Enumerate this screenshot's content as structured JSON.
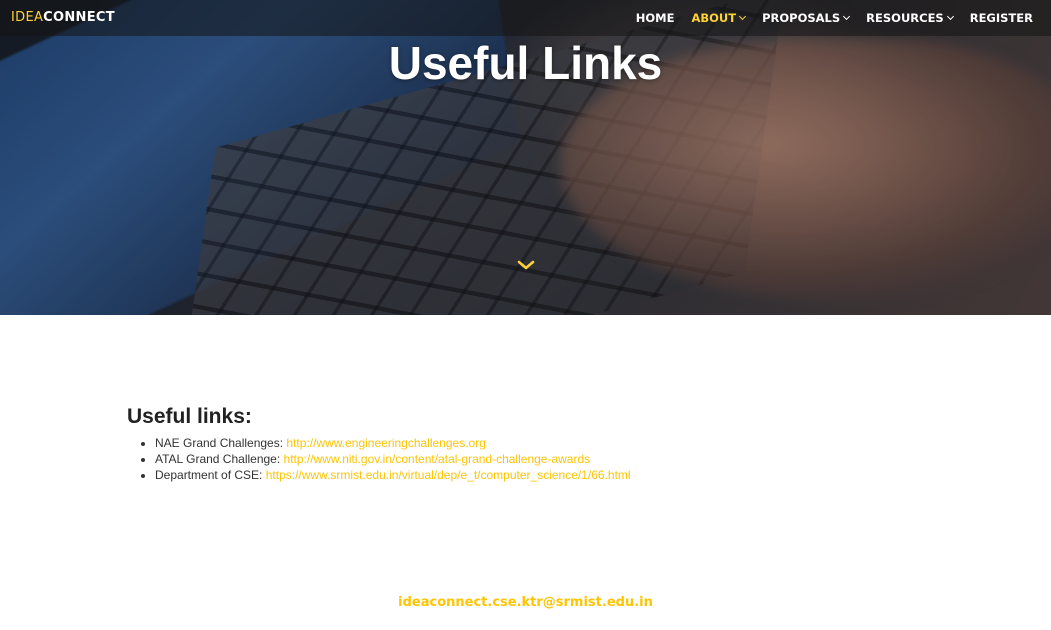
{
  "brand": {
    "part1": "IDEA",
    "part2": "CONNECT"
  },
  "nav": {
    "items": [
      {
        "label": "HOME",
        "has_dropdown": false,
        "active": false
      },
      {
        "label": "ABOUT",
        "has_dropdown": true,
        "active": true
      },
      {
        "label": "PROPOSALS",
        "has_dropdown": true,
        "active": false
      },
      {
        "label": "RESOURCES",
        "has_dropdown": true,
        "active": false
      },
      {
        "label": "REGISTER",
        "has_dropdown": false,
        "active": false
      }
    ]
  },
  "hero": {
    "title": "Useful Links",
    "scroll_icon": "chevron-down-icon"
  },
  "main": {
    "heading": "Useful links:",
    "links": [
      {
        "label": "NAE Grand Challenges:",
        "url": "http://www.engineeringchallenges.org"
      },
      {
        "label": "ATAL Grand Challenge:",
        "url": "http://www.niti.gov.in/content/atal-grand-challenge-awards"
      },
      {
        "label": "Department of CSE:",
        "url": "https://www.srmist.edu.in/virtual/dep/e_t/computer_science/1/66.html"
      }
    ]
  },
  "footer": {
    "email": "ideaconnect.cse.ktr@srmist.edu.in"
  },
  "colors": {
    "accent": "#fed136",
    "link": "#fec503",
    "text": "#333333"
  }
}
